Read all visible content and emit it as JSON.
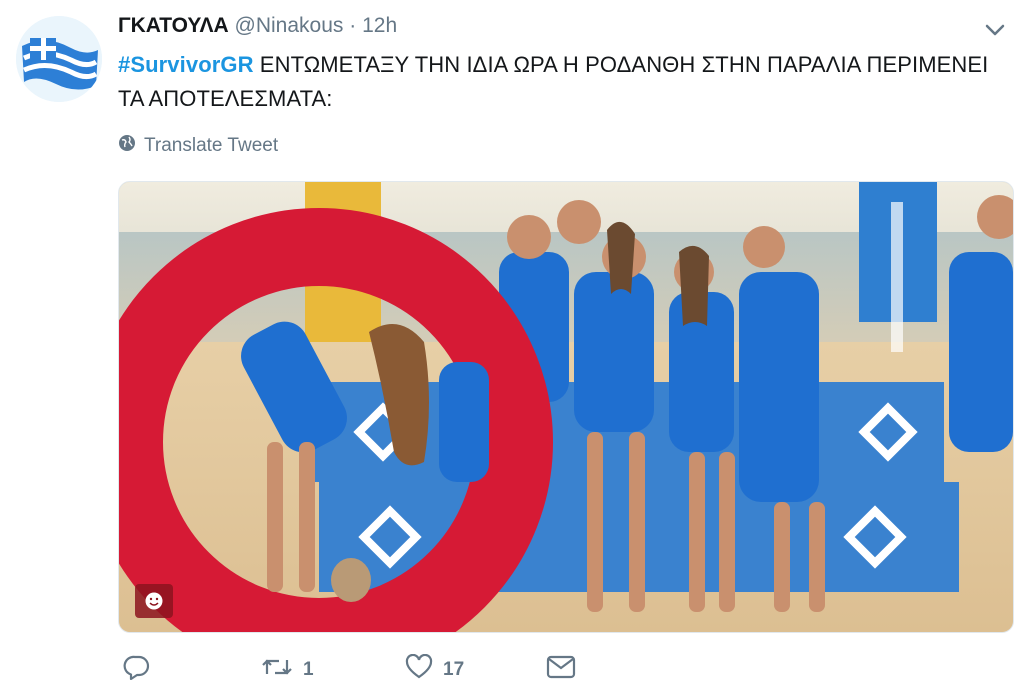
{
  "author": {
    "display_name": "ΓΚΑΤΟΥΛΑ",
    "handle": "@Ninakous",
    "separator": "·",
    "time": "12h"
  },
  "tweet": {
    "hashtag": "#SurvivorGR",
    "text": " ΕΝΤΩΜΕΤΑΞΥ ΤΗΝ ΙΔΙΑ ΩΡΑ Η ΡΟΔΑΝΘΗ ΣΤΗΝ ΠΑΡΑΛΙΑ ΠΕΡΙΜΕΝΕΙ ΤΑ ΑΠΟΤΕΛΕΣΜΑΤΑ:"
  },
  "translate_label": "Translate Tweet",
  "actions": {
    "reply_count": "",
    "retweet_count": "1",
    "like_count": "17"
  },
  "icons": [
    "greek-flag-avatar",
    "chevron-down-icon",
    "globe-icon",
    "reply-icon",
    "retweet-icon",
    "heart-icon",
    "envelope-icon",
    "smiley-icon"
  ],
  "colors": {
    "hashtag": "#1b95e0",
    "secondary_text": "#657786",
    "highlight_circle": "#d61a35",
    "team_blue": "#1f6fd0"
  }
}
